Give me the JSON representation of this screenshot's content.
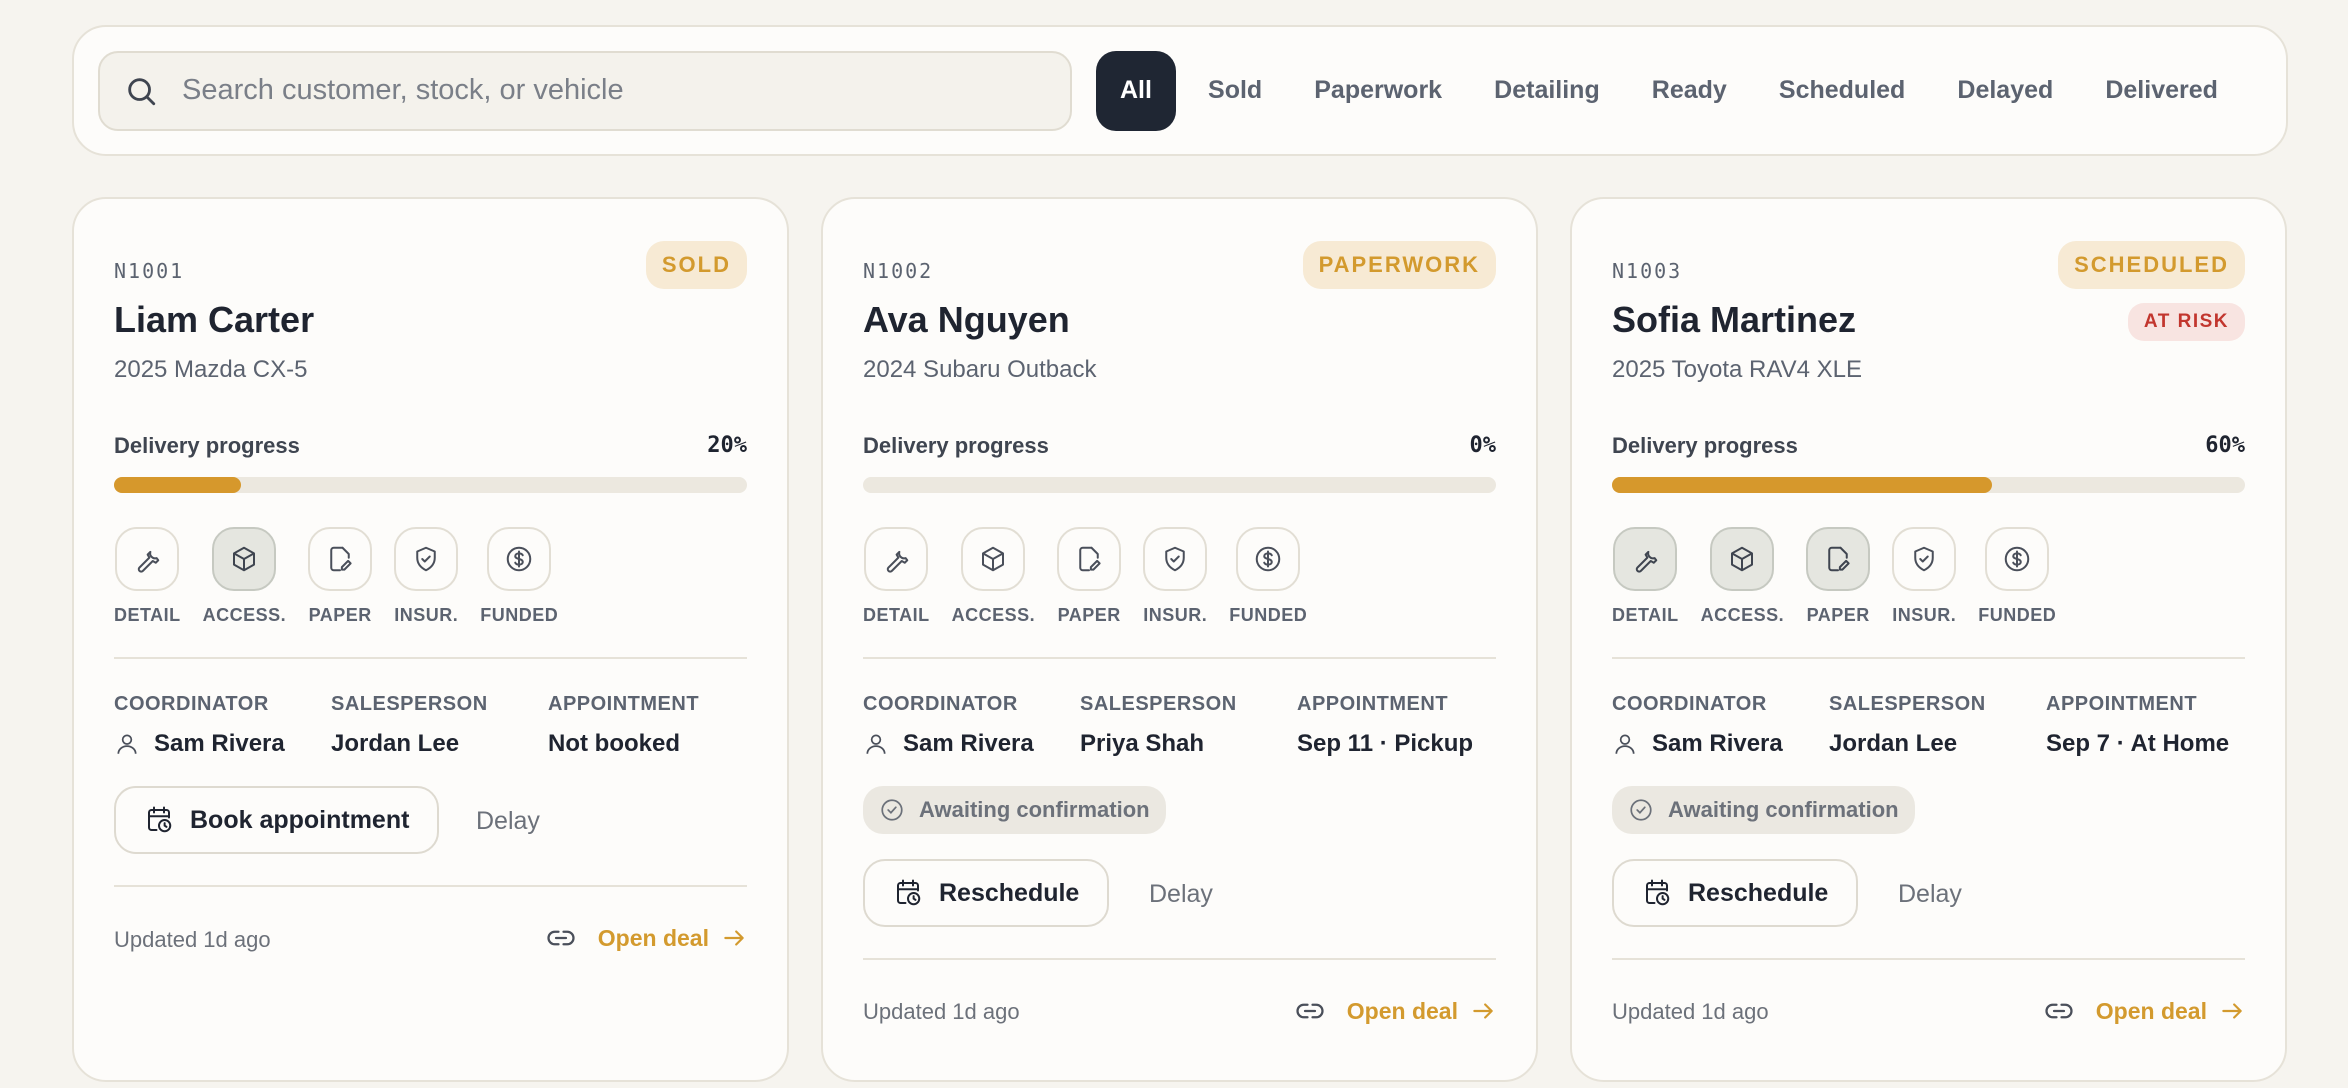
{
  "search": {
    "placeholder": "Search customer, stock, or vehicle"
  },
  "filters": [
    "All",
    "Sold",
    "Paperwork",
    "Detailing",
    "Ready",
    "Scheduled",
    "Delayed",
    "Delivered"
  ],
  "active_filter": "All",
  "step_labels": [
    "DETAIL",
    "ACCESS.",
    "PAPER",
    "INSUR.",
    "FUNDED"
  ],
  "meta_labels": {
    "coordinator": "COORDINATOR",
    "salesperson": "SALESPERSON",
    "appointment": "APPOINTMENT"
  },
  "progress_label": "Delivery progress",
  "delay_label": "Delay",
  "open_label": "Open deal",
  "colors": {
    "accent": "#d6982c",
    "dark": "#1f2633",
    "risk": "#c2362e"
  },
  "cards": [
    {
      "stock": "N1001",
      "status": "SOLD",
      "customer": "Liam Carter",
      "vehicle": "2025 Mazda CX-5",
      "progress": "20%",
      "progress_fraction": 0.2,
      "steps_done": [
        false,
        true,
        false,
        false,
        false
      ],
      "coordinator": "Sam Rivera",
      "salesperson": "Jordan Lee",
      "appointment": "Not booked",
      "action": "Book appointment",
      "updated": "Updated 1d ago"
    },
    {
      "stock": "N1002",
      "status": "PAPERWORK",
      "customer": "Ava Nguyen",
      "vehicle": "2024 Subaru Outback",
      "progress": "0%",
      "progress_fraction": 0.0,
      "steps_done": [
        false,
        false,
        false,
        false,
        false
      ],
      "coordinator": "Sam Rivera",
      "salesperson": "Priya Shah",
      "appointment": "Sep 11 · Pickup",
      "await": "Awaiting confirmation",
      "action": "Reschedule",
      "updated": "Updated 1d ago"
    },
    {
      "stock": "N1003",
      "status": "SCHEDULED",
      "risk": "AT RISK",
      "customer": "Sofia Martinez",
      "vehicle": "2025 Toyota RAV4 XLE",
      "progress": "60%",
      "progress_fraction": 0.6,
      "steps_done": [
        true,
        true,
        true,
        false,
        false
      ],
      "coordinator": "Sam Rivera",
      "salesperson": "Jordan Lee",
      "appointment": "Sep 7 · At Home",
      "await": "Awaiting confirmation",
      "action": "Reschedule",
      "updated": "Updated 1d ago"
    }
  ]
}
